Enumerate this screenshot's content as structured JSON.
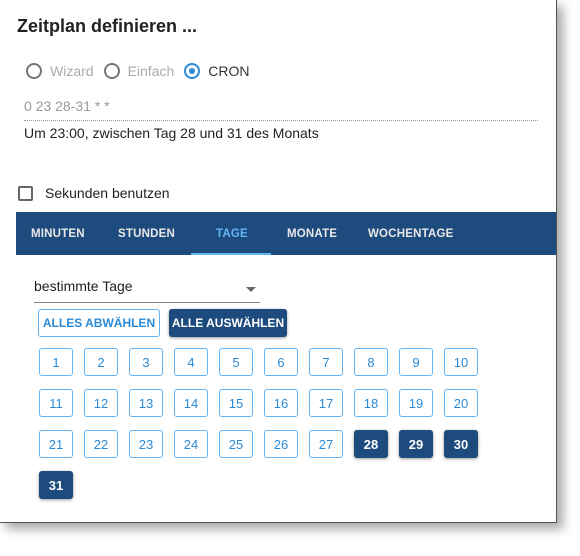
{
  "title": "Zeitplan definieren ...",
  "mode": {
    "options": [
      "Wizard",
      "Einfach",
      "CRON"
    ],
    "selected": "CRON"
  },
  "cron": {
    "expression": "0 23 28-31 * *",
    "description": "Um 23:00, zwischen Tag 28 und 31 des Monats"
  },
  "seconds_label": "Sekunden benutzen",
  "tabs": [
    "MINUTEN",
    "STUNDEN",
    "TAGE",
    "MONATE",
    "WOCHENTAGE"
  ],
  "active_tab": "TAGE",
  "day_mode_select": "bestimmte Tage",
  "buttons": {
    "deselect_all": "ALLES ABWÄHLEN",
    "select_all": "ALLE AUSWÄHLEN"
  },
  "days": [
    "1",
    "2",
    "3",
    "4",
    "5",
    "6",
    "7",
    "8",
    "9",
    "10",
    "11",
    "12",
    "13",
    "14",
    "15",
    "16",
    "17",
    "18",
    "19",
    "20",
    "21",
    "22",
    "23",
    "24",
    "25",
    "26",
    "27",
    "28",
    "29",
    "30",
    "31"
  ],
  "selected_days": [
    "28",
    "29",
    "30",
    "31"
  ],
  "colors": {
    "primary": "#1e4b7e",
    "accent": "#64b5f6",
    "radio_checked": "#2a8ad6"
  }
}
